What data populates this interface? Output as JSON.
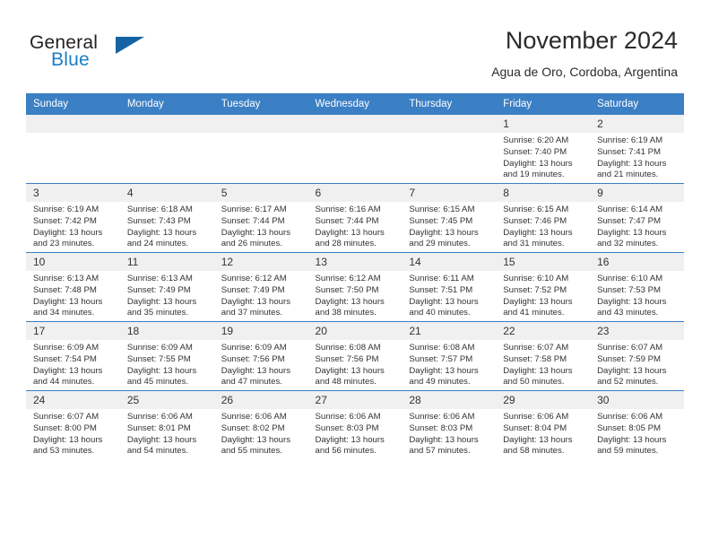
{
  "brand": {
    "name_part1": "General",
    "name_part2": "Blue",
    "logo_icon": "triangle-logo-icon",
    "accent_color": "#1c7cc4",
    "logo_color": "#1464a5"
  },
  "header": {
    "title": "November 2024",
    "subtitle": "Agua de Oro, Cordoba, Argentina"
  },
  "theme": {
    "header_blue": "#3b7fc4",
    "daynum_band": "#f0f0f0",
    "text": "#333333"
  },
  "calendar": {
    "columns": [
      "Sunday",
      "Monday",
      "Tuesday",
      "Wednesday",
      "Thursday",
      "Friday",
      "Saturday"
    ],
    "weeks": [
      [
        {
          "day": "",
          "empty": true,
          "sunrise": "",
          "sunset": "",
          "daylight_line1": "",
          "daylight_line2": ""
        },
        {
          "day": "",
          "empty": true,
          "sunrise": "",
          "sunset": "",
          "daylight_line1": "",
          "daylight_line2": ""
        },
        {
          "day": "",
          "empty": true,
          "sunrise": "",
          "sunset": "",
          "daylight_line1": "",
          "daylight_line2": ""
        },
        {
          "day": "",
          "empty": true,
          "sunrise": "",
          "sunset": "",
          "daylight_line1": "",
          "daylight_line2": ""
        },
        {
          "day": "",
          "empty": true,
          "sunrise": "",
          "sunset": "",
          "daylight_line1": "",
          "daylight_line2": ""
        },
        {
          "day": "1",
          "empty": false,
          "sunrise": "Sunrise: 6:20 AM",
          "sunset": "Sunset: 7:40 PM",
          "daylight_line1": "Daylight: 13 hours",
          "daylight_line2": "and 19 minutes."
        },
        {
          "day": "2",
          "empty": false,
          "sunrise": "Sunrise: 6:19 AM",
          "sunset": "Sunset: 7:41 PM",
          "daylight_line1": "Daylight: 13 hours",
          "daylight_line2": "and 21 minutes."
        }
      ],
      [
        {
          "day": "3",
          "empty": false,
          "sunrise": "Sunrise: 6:19 AM",
          "sunset": "Sunset: 7:42 PM",
          "daylight_line1": "Daylight: 13 hours",
          "daylight_line2": "and 23 minutes."
        },
        {
          "day": "4",
          "empty": false,
          "sunrise": "Sunrise: 6:18 AM",
          "sunset": "Sunset: 7:43 PM",
          "daylight_line1": "Daylight: 13 hours",
          "daylight_line2": "and 24 minutes."
        },
        {
          "day": "5",
          "empty": false,
          "sunrise": "Sunrise: 6:17 AM",
          "sunset": "Sunset: 7:44 PM",
          "daylight_line1": "Daylight: 13 hours",
          "daylight_line2": "and 26 minutes."
        },
        {
          "day": "6",
          "empty": false,
          "sunrise": "Sunrise: 6:16 AM",
          "sunset": "Sunset: 7:44 PM",
          "daylight_line1": "Daylight: 13 hours",
          "daylight_line2": "and 28 minutes."
        },
        {
          "day": "7",
          "empty": false,
          "sunrise": "Sunrise: 6:15 AM",
          "sunset": "Sunset: 7:45 PM",
          "daylight_line1": "Daylight: 13 hours",
          "daylight_line2": "and 29 minutes."
        },
        {
          "day": "8",
          "empty": false,
          "sunrise": "Sunrise: 6:15 AM",
          "sunset": "Sunset: 7:46 PM",
          "daylight_line1": "Daylight: 13 hours",
          "daylight_line2": "and 31 minutes."
        },
        {
          "day": "9",
          "empty": false,
          "sunrise": "Sunrise: 6:14 AM",
          "sunset": "Sunset: 7:47 PM",
          "daylight_line1": "Daylight: 13 hours",
          "daylight_line2": "and 32 minutes."
        }
      ],
      [
        {
          "day": "10",
          "empty": false,
          "sunrise": "Sunrise: 6:13 AM",
          "sunset": "Sunset: 7:48 PM",
          "daylight_line1": "Daylight: 13 hours",
          "daylight_line2": "and 34 minutes."
        },
        {
          "day": "11",
          "empty": false,
          "sunrise": "Sunrise: 6:13 AM",
          "sunset": "Sunset: 7:49 PM",
          "daylight_line1": "Daylight: 13 hours",
          "daylight_line2": "and 35 minutes."
        },
        {
          "day": "12",
          "empty": false,
          "sunrise": "Sunrise: 6:12 AM",
          "sunset": "Sunset: 7:49 PM",
          "daylight_line1": "Daylight: 13 hours",
          "daylight_line2": "and 37 minutes."
        },
        {
          "day": "13",
          "empty": false,
          "sunrise": "Sunrise: 6:12 AM",
          "sunset": "Sunset: 7:50 PM",
          "daylight_line1": "Daylight: 13 hours",
          "daylight_line2": "and 38 minutes."
        },
        {
          "day": "14",
          "empty": false,
          "sunrise": "Sunrise: 6:11 AM",
          "sunset": "Sunset: 7:51 PM",
          "daylight_line1": "Daylight: 13 hours",
          "daylight_line2": "and 40 minutes."
        },
        {
          "day": "15",
          "empty": false,
          "sunrise": "Sunrise: 6:10 AM",
          "sunset": "Sunset: 7:52 PM",
          "daylight_line1": "Daylight: 13 hours",
          "daylight_line2": "and 41 minutes."
        },
        {
          "day": "16",
          "empty": false,
          "sunrise": "Sunrise: 6:10 AM",
          "sunset": "Sunset: 7:53 PM",
          "daylight_line1": "Daylight: 13 hours",
          "daylight_line2": "and 43 minutes."
        }
      ],
      [
        {
          "day": "17",
          "empty": false,
          "sunrise": "Sunrise: 6:09 AM",
          "sunset": "Sunset: 7:54 PM",
          "daylight_line1": "Daylight: 13 hours",
          "daylight_line2": "and 44 minutes."
        },
        {
          "day": "18",
          "empty": false,
          "sunrise": "Sunrise: 6:09 AM",
          "sunset": "Sunset: 7:55 PM",
          "daylight_line1": "Daylight: 13 hours",
          "daylight_line2": "and 45 minutes."
        },
        {
          "day": "19",
          "empty": false,
          "sunrise": "Sunrise: 6:09 AM",
          "sunset": "Sunset: 7:56 PM",
          "daylight_line1": "Daylight: 13 hours",
          "daylight_line2": "and 47 minutes."
        },
        {
          "day": "20",
          "empty": false,
          "sunrise": "Sunrise: 6:08 AM",
          "sunset": "Sunset: 7:56 PM",
          "daylight_line1": "Daylight: 13 hours",
          "daylight_line2": "and 48 minutes."
        },
        {
          "day": "21",
          "empty": false,
          "sunrise": "Sunrise: 6:08 AM",
          "sunset": "Sunset: 7:57 PM",
          "daylight_line1": "Daylight: 13 hours",
          "daylight_line2": "and 49 minutes."
        },
        {
          "day": "22",
          "empty": false,
          "sunrise": "Sunrise: 6:07 AM",
          "sunset": "Sunset: 7:58 PM",
          "daylight_line1": "Daylight: 13 hours",
          "daylight_line2": "and 50 minutes."
        },
        {
          "day": "23",
          "empty": false,
          "sunrise": "Sunrise: 6:07 AM",
          "sunset": "Sunset: 7:59 PM",
          "daylight_line1": "Daylight: 13 hours",
          "daylight_line2": "and 52 minutes."
        }
      ],
      [
        {
          "day": "24",
          "empty": false,
          "sunrise": "Sunrise: 6:07 AM",
          "sunset": "Sunset: 8:00 PM",
          "daylight_line1": "Daylight: 13 hours",
          "daylight_line2": "and 53 minutes."
        },
        {
          "day": "25",
          "empty": false,
          "sunrise": "Sunrise: 6:06 AM",
          "sunset": "Sunset: 8:01 PM",
          "daylight_line1": "Daylight: 13 hours",
          "daylight_line2": "and 54 minutes."
        },
        {
          "day": "26",
          "empty": false,
          "sunrise": "Sunrise: 6:06 AM",
          "sunset": "Sunset: 8:02 PM",
          "daylight_line1": "Daylight: 13 hours",
          "daylight_line2": "and 55 minutes."
        },
        {
          "day": "27",
          "empty": false,
          "sunrise": "Sunrise: 6:06 AM",
          "sunset": "Sunset: 8:03 PM",
          "daylight_line1": "Daylight: 13 hours",
          "daylight_line2": "and 56 minutes."
        },
        {
          "day": "28",
          "empty": false,
          "sunrise": "Sunrise: 6:06 AM",
          "sunset": "Sunset: 8:03 PM",
          "daylight_line1": "Daylight: 13 hours",
          "daylight_line2": "and 57 minutes."
        },
        {
          "day": "29",
          "empty": false,
          "sunrise": "Sunrise: 6:06 AM",
          "sunset": "Sunset: 8:04 PM",
          "daylight_line1": "Daylight: 13 hours",
          "daylight_line2": "and 58 minutes."
        },
        {
          "day": "30",
          "empty": false,
          "sunrise": "Sunrise: 6:06 AM",
          "sunset": "Sunset: 8:05 PM",
          "daylight_line1": "Daylight: 13 hours",
          "daylight_line2": "and 59 minutes."
        }
      ]
    ]
  }
}
